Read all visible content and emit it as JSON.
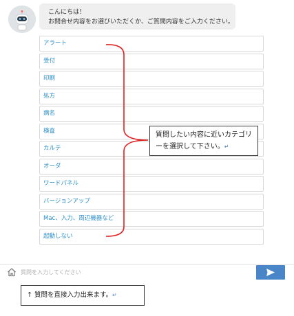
{
  "bot": {
    "avatar_icon": "robot-icon",
    "greeting": "こんにちは！",
    "prompt": "お問合せ内容をお選びいただくか、ご質問内容をご入力ください。"
  },
  "categories": [
    {
      "label": "アラート"
    },
    {
      "label": "受付"
    },
    {
      "label": "印刷"
    },
    {
      "label": "処方"
    },
    {
      "label": "病名"
    },
    {
      "label": "検査"
    },
    {
      "label": "カルテ"
    },
    {
      "label": "オーダ"
    },
    {
      "label": "ワードパネル"
    },
    {
      "label": "バージョンアップ"
    },
    {
      "label": "Mac、入力、周辺機器など"
    },
    {
      "label": "起動しない"
    }
  ],
  "annotations": {
    "category_note": "質問したい内容に近いカテゴリーを選択して下さい。",
    "input_note": "↑ 質問を直接入力出来ます。",
    "return_mark": "↵"
  },
  "input": {
    "placeholder": "質問を入力してください",
    "value": ""
  },
  "icons": {
    "home": "home-icon",
    "send": "send-icon"
  },
  "colors": {
    "link_text": "#2a8ec9",
    "send_button": "#4a86c7",
    "bracket": "#e02020",
    "bubble_bg": "#efefef"
  }
}
